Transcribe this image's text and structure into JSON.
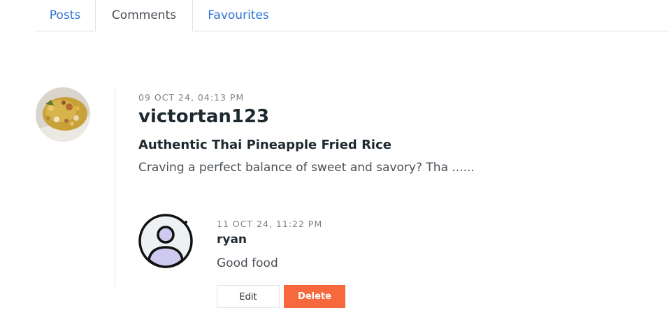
{
  "tabs": {
    "posts": "Posts",
    "comments": "Comments",
    "favourites": "Favourites",
    "active": "Comments"
  },
  "post": {
    "date": "09 OCT 24, 04:13 PM",
    "author": "victortan123",
    "title": "Authentic Thai Pineapple Fried Rice",
    "excerpt": "Craving a perfect balance of sweet and savory? Tha ......",
    "avatar_icon": "food-photo"
  },
  "reply": {
    "date": "11 OCT 24, 11:22 PM",
    "author": "ryan",
    "text": "Good food",
    "avatar_icon": "user-avatar-icon",
    "edit_label": "Edit",
    "delete_label": "Delete"
  },
  "colors": {
    "link": "#2b73d6",
    "delete": "#f7693d",
    "avatar_bg": "#cfcaf0"
  }
}
